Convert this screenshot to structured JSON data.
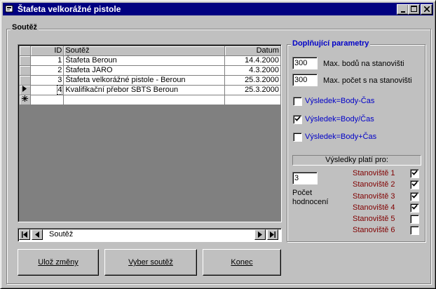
{
  "window": {
    "title": "Štafeta velkorážné pistole"
  },
  "form": {
    "group_title": "Soutěž"
  },
  "grid": {
    "columns": [
      "ID",
      "Soutěž",
      "Datum"
    ],
    "rows": [
      {
        "id": "1",
        "name": "Štafeta Beroun",
        "date": "14.4.2000"
      },
      {
        "id": "2",
        "name": "Štafeta JARO",
        "date": "4.3.2000"
      },
      {
        "id": "3",
        "name": "Štafeta velkorážné pistole - Beroun",
        "date": "25.3.2000"
      },
      {
        "id": "4",
        "name": "Kvalifikační přebor SBTS Beroun",
        "date": "25.3.2000"
      }
    ]
  },
  "navigator": {
    "caption": "Soutěž"
  },
  "buttons": {
    "save": "Ulož změny",
    "select": "Vyber soutěž",
    "exit": "Konec"
  },
  "params": {
    "title": "Doplňující parametry",
    "max_points": {
      "value": "300",
      "label": "Max. bodů na stanovišti"
    },
    "max_time": {
      "value": "300",
      "label": "Max. počet s na stanovišti"
    },
    "formulas": [
      {
        "label": "Výsledek=Body-Čas",
        "checked": false
      },
      {
        "label": "Výsledek=Body/Čas",
        "checked": true
      },
      {
        "label": "Výsledek=Body+Čas",
        "checked": false
      }
    ],
    "results_header": "Výsledky platí pro:",
    "eval_count": {
      "value": "3",
      "label_line1": "Počet",
      "label_line2": "hodnocení"
    },
    "stations": [
      {
        "label": "Stanoviště 1",
        "checked": true
      },
      {
        "label": "Stanoviště 2",
        "checked": true
      },
      {
        "label": "Stanoviště 3",
        "checked": true
      },
      {
        "label": "Stanoviště 4",
        "checked": true
      },
      {
        "label": "Stanoviště 5",
        "checked": false
      },
      {
        "label": "Stanoviště 6",
        "checked": false
      }
    ]
  },
  "colors": {
    "titlebar": "#000080",
    "face": "#c0c0c0",
    "link_blue": "#0000c8",
    "station_red": "#800000"
  }
}
